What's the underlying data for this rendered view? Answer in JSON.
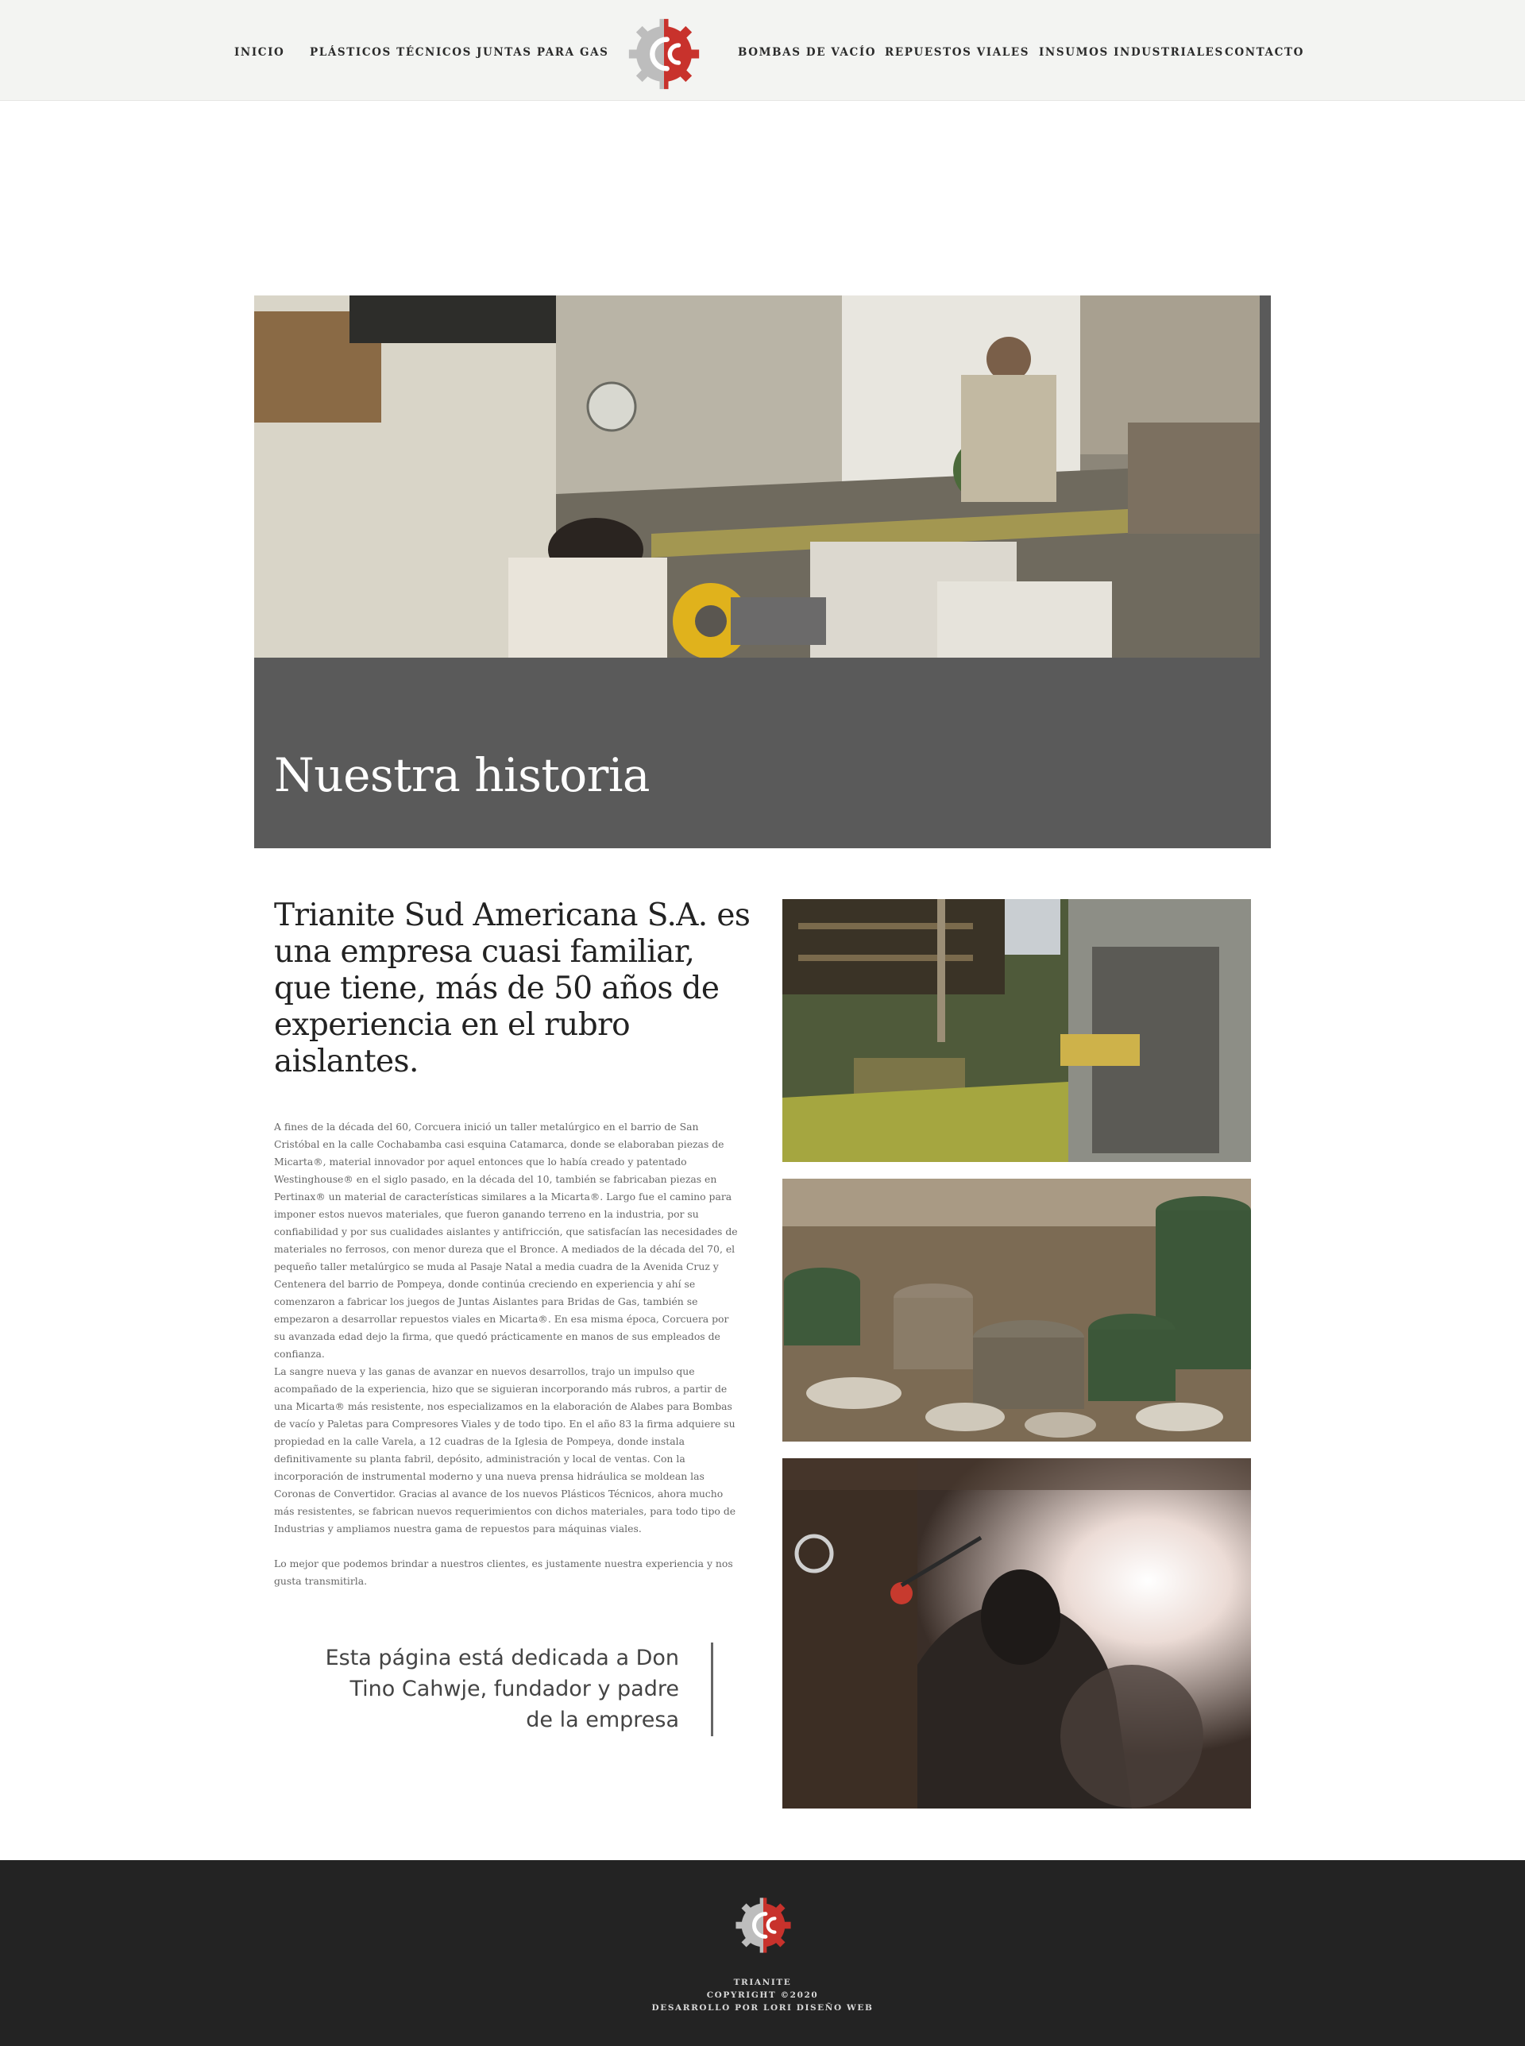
{
  "nav": {
    "left": [
      "INICIO",
      "PLÁSTICOS TÉCNICOS",
      "JUNTAS PARA GAS"
    ],
    "right": [
      "BOMBAS DE VACÍO",
      "REPUESTOS VIALES",
      "INSUMOS INDUSTRIALES",
      "CONTACTO"
    ]
  },
  "brand": {
    "logo_icon": "gear-c-logo-icon",
    "red": "#c8322c",
    "gray": "#bdbdbd"
  },
  "hero": {
    "title": "Nuestra historia",
    "photo": "workshop-photo"
  },
  "content": {
    "lead": "Trianite Sud Americana S.A. es una empresa cuasi familiar, que tiene, más de 50 años de experiencia en el rubro aislantes.",
    "paragraphs": [
      "A fines de la década del 60, Corcuera inició un taller metalúrgico en el barrio de San Cristóbal en la calle Cochabamba casi esquina Catamarca, donde se elaboraban piezas de Micarta®, material innovador por aquel entonces que lo había creado y patentado Westinghouse® en el siglo pasado, en la década del 10, también se fabricaban piezas en Pertinax® un material de características similares a la Micarta®. Largo fue el camino para imponer estos nuevos materiales, que fueron ganando terreno en la industria, por su confiabilidad y por sus cualidades aislantes y antifricción, que satisfacían las necesidades de materiales no ferrosos, con menor dureza que el Bronce. A mediados de la década del 70, el pequeño taller metalúrgico se muda al Pasaje Natal a media cuadra de la Avenida Cruz y Centenera del barrio de Pompeya, donde continúa creciendo en experiencia y ahí se comenzaron a fabricar los juegos de Juntas Aislantes para Bridas de Gas, también se empezaron a desarrollar repuestos viales en Micarta®. En esa misma época, Corcuera por su avanzada edad dejo la firma, que quedó prácticamente en manos de sus empleados de confianza.",
      "La sangre nueva y las ganas de avanzar en nuevos desarrollos, trajo un impulso que acompañado de la experiencia, hizo que se siguieran incorporando más rubros, a partir de una Micarta® más resistente, nos especializamos en la elaboración de Alabes para Bombas de vacío y Paletas para Compresores Viales y de todo tipo. En el año 83 la firma adquiere su propiedad en la calle Varela, a 12 cuadras de la Iglesia de Pompeya, donde instala definitivamente su planta fabril, depósito, administración y local de ventas. Con la incorporación de instrumental moderno y una nueva prensa hidráulica se moldean las Coronas de Convertidor. Gracias al avance de los nuevos Plásticos Técnicos, ahora mucho más resistentes, se fabrican nuevos requerimientos con dichos materiales, para todo tipo de Industrias y ampliamos nuestra gama de repuestos para máquinas viales.",
      "Lo mejor que podemos brindar a nuestros clientes, es justamente nuestra experiencia y nos gusta transmitirla."
    ],
    "quote": "Esta página está dedicada a Don Tino Cahwje, fundador y padre de la empresa"
  },
  "gallery": [
    "factory-press-photo",
    "gasket-stock-photo",
    "welder-photo"
  ],
  "footer": {
    "name": "TRIANITE",
    "copyright": "COPYRIGHT ©2020",
    "credit": "DESARROLLO POR LORI DISEÑO WEB"
  }
}
